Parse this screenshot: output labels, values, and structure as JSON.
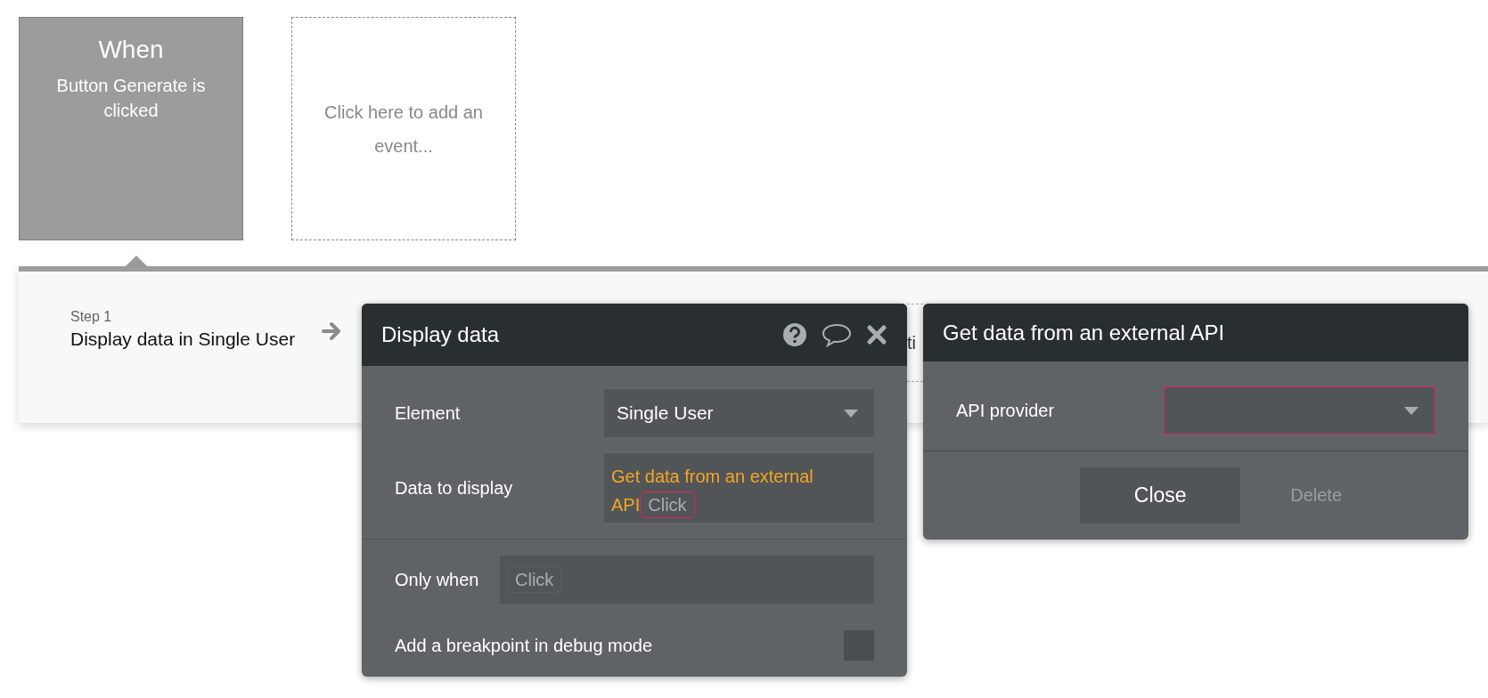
{
  "trigger_card": {
    "title": "When",
    "description": "Button Generate is clicked"
  },
  "add_event_card": {
    "placeholder": "Click here to add an event..."
  },
  "step": {
    "label": "Step 1",
    "action": "Display data in Single User"
  },
  "hidden_action_text": "ti",
  "display_panel": {
    "title": "Display data",
    "fields": [
      {
        "kind": "dropdown",
        "label": "Element",
        "value": "Single User"
      },
      {
        "kind": "expression",
        "label": "Data to display",
        "value_lines": [
          "Get data from an external",
          "API"
        ],
        "chip": "Click",
        "invalid": true
      }
    ],
    "only_when": {
      "label": "Only when",
      "chip": "Click"
    },
    "breakpoint": {
      "label": "Add a breakpoint in debug mode",
      "checked": false
    }
  },
  "api_panel": {
    "title": "Get data from an external API",
    "provider": {
      "label": "API provider",
      "invalid": true
    },
    "buttons": [
      {
        "label": "Close",
        "disabled": false
      },
      {
        "label": "Delete",
        "disabled": true
      }
    ]
  }
}
